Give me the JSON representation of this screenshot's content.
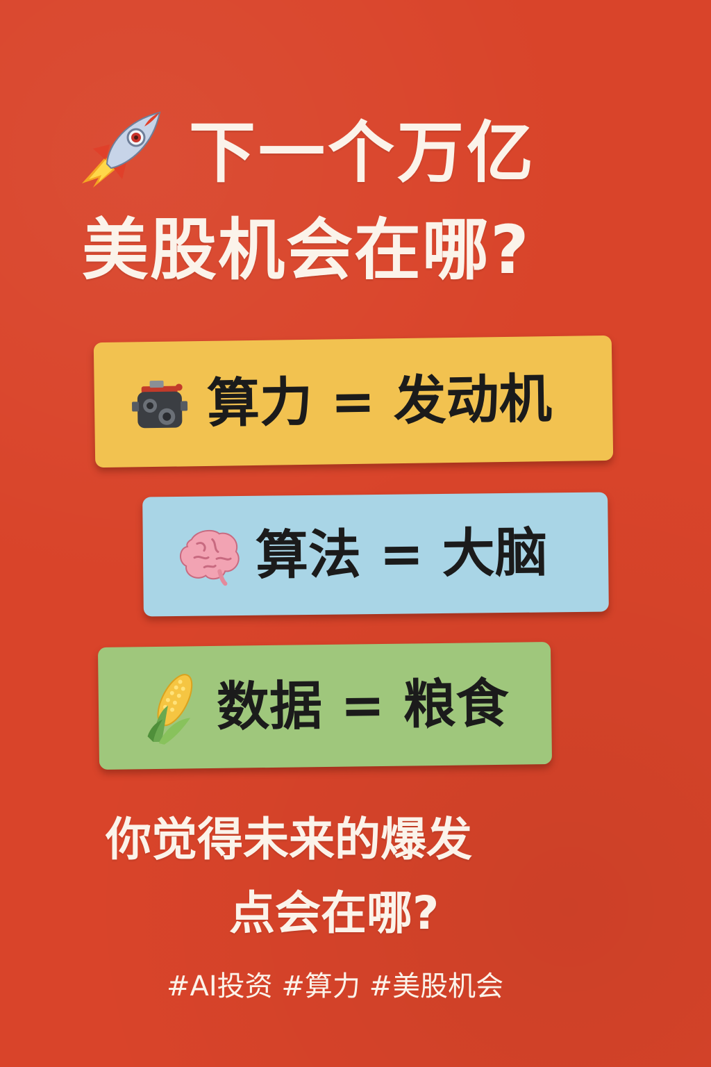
{
  "title": {
    "icon": "rocket-icon",
    "line1": "下一个万亿",
    "line2": "美股机会在哪?"
  },
  "cards": [
    {
      "icon": "engine-icon",
      "text": "算力 = 发动机",
      "color": "#f2c250"
    },
    {
      "icon": "brain-icon",
      "text": "算法 = 大脑",
      "color": "#a9d5e6"
    },
    {
      "icon": "corn-icon",
      "text": "数据 = 粮食",
      "color": "#9fc77c"
    }
  ],
  "question": {
    "line1": "你觉得未来的爆发",
    "line2": "点会在哪?"
  },
  "hashtags": "#AI投资 #算力 #美股机会",
  "colors": {
    "background": "#d9442a",
    "text_light": "#fbf3ea",
    "text_dark": "#1b1b1b"
  }
}
